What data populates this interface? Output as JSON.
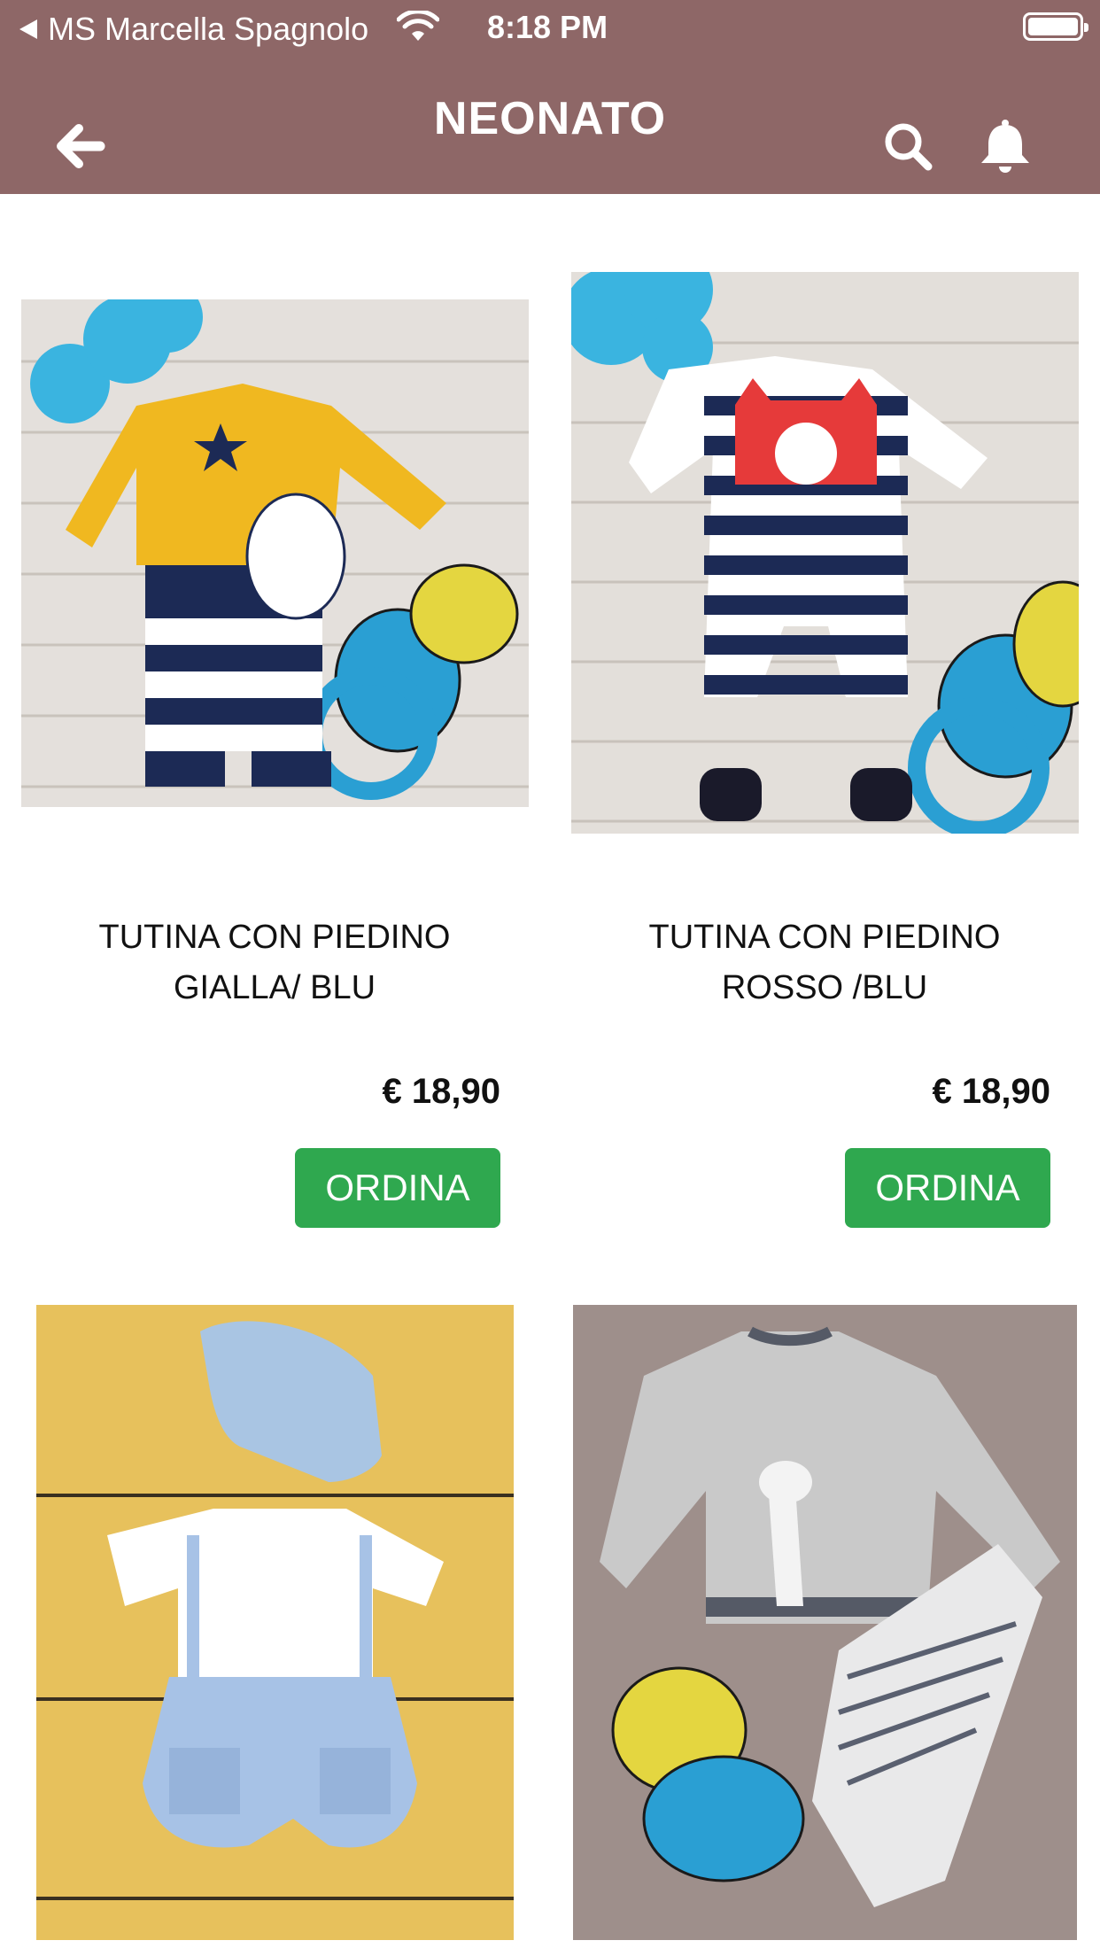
{
  "status_bar": {
    "back_app_label": "MS Marcella Spagnolo",
    "time": "8:18 PM"
  },
  "header": {
    "title": "NEONATO",
    "icons": [
      "back-arrow-icon",
      "search-icon",
      "bell-icon"
    ]
  },
  "colors": {
    "header_bg": "#8e6767",
    "order_button": "#2fa84f"
  },
  "products": [
    {
      "name_line1": "TUTINA CON PIEDINO",
      "name_line2": "GIALLA/ BLU",
      "price": "€ 18,90",
      "button": "ORDINA"
    },
    {
      "name_line1": "TUTINA CON PIEDINO",
      "name_line2": "ROSSO /BLU",
      "price": "€ 18,90",
      "button": "ORDINA"
    },
    {},
    {}
  ]
}
